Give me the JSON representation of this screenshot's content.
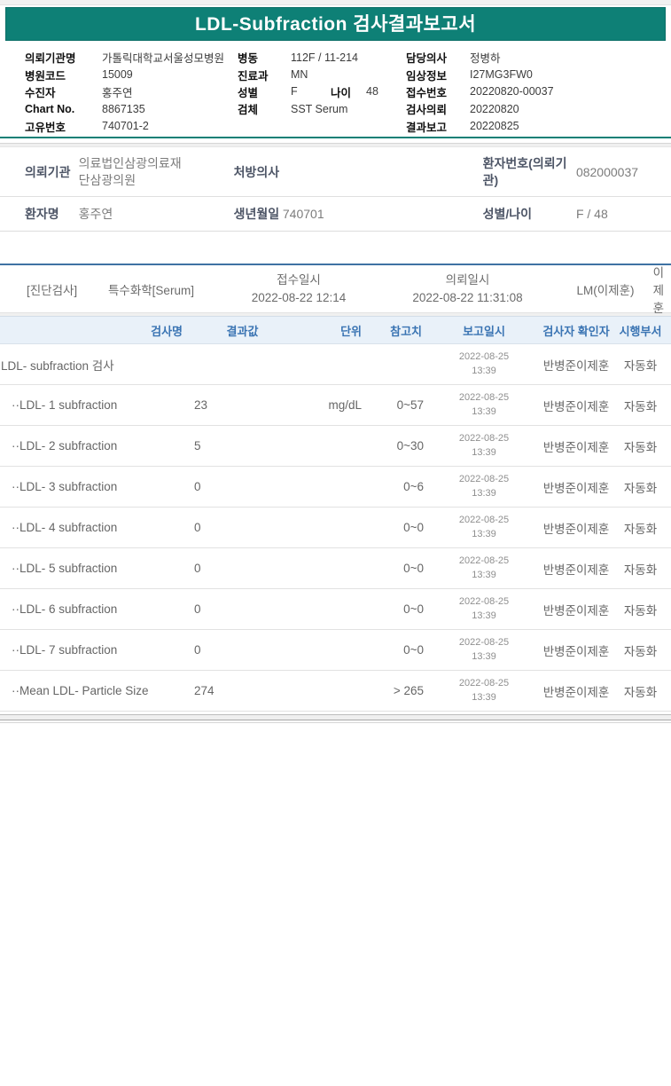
{
  "title": "LDL-Subfraction 검사결과보고서",
  "patient_info": {
    "col1": [
      {
        "label": "의뢰기관명",
        "value": "가톨릭대학교서울성모병원"
      },
      {
        "label": "병원코드",
        "value": "15009"
      },
      {
        "label": "수진자",
        "value": "홍주연"
      },
      {
        "label": "Chart No.",
        "value": "8867135"
      },
      {
        "label": "고유번호",
        "value": "740701-2"
      }
    ],
    "col2": [
      {
        "label": "병동",
        "value": "112F / 11-214"
      },
      {
        "label": "진료과",
        "value": "MN"
      },
      {
        "label": "성별",
        "value": "F",
        "label2": "나이",
        "value2": "48"
      },
      {
        "label": "검체",
        "value": "SST Serum"
      }
    ],
    "col3": [
      {
        "label": "담당의사",
        "value": "정병하"
      },
      {
        "label": "임상정보",
        "value": "I27MG3FW0"
      },
      {
        "label": "접수번호",
        "value": "20220820-00037"
      },
      {
        "label": "검사의뢰",
        "value": "20220820"
      },
      {
        "label": "결과보고",
        "value": "20220825"
      }
    ]
  },
  "referral": {
    "row1": {
      "org_label": "의뢰기관",
      "org_value": "의료법인삼광의료재단삼광의원",
      "doctor_label": "처방의사",
      "doctor_value": "",
      "patient_no_label": "환자번호(의뢰기관)",
      "patient_no_value": "082000037"
    },
    "row2": {
      "name_label": "환자명",
      "name_value": "홍주연",
      "birth_label": "생년월일",
      "birth_value": "740701",
      "sexage_label": "성별/나이",
      "sexage_value": "F / 48"
    }
  },
  "exam_section": {
    "category": "[진단검사]",
    "test_group": "특수화학[Serum]",
    "receipt_label": "접수일시",
    "receipt_value": "2022-08-22 12:14",
    "request_label": "의뢰일시",
    "request_value": "2022-08-22 11:31:08",
    "lab": "LM(이제훈)",
    "reporter": "이제훈"
  },
  "results_table": {
    "headers": {
      "name": "검사명",
      "result": "결과값",
      "unit": "단위",
      "reference": "참고치",
      "report": "보고일시",
      "examiner": "검사자 확인자",
      "department": "시행부서"
    },
    "rows": [
      {
        "name": "LDL- subfraction 검사",
        "result": "",
        "unit": "",
        "reference": "",
        "report_date": "2022-08-25",
        "report_time": "13:39",
        "examiner": "반병준이제훈",
        "department": "자동화"
      },
      {
        "name": "··LDL- 1 subfraction",
        "result": "23",
        "unit": "mg/dL",
        "reference": "0~57",
        "report_date": "2022-08-25",
        "report_time": "13:39",
        "examiner": "반병준이제훈",
        "department": "자동화"
      },
      {
        "name": "··LDL- 2 subfraction",
        "result": "5",
        "unit": "",
        "reference": "0~30",
        "report_date": "2022-08-25",
        "report_time": "13:39",
        "examiner": "반병준이제훈",
        "department": "자동화"
      },
      {
        "name": "··LDL- 3 subfraction",
        "result": "0",
        "unit": "",
        "reference": "0~6",
        "report_date": "2022-08-25",
        "report_time": "13:39",
        "examiner": "반병준이제훈",
        "department": "자동화"
      },
      {
        "name": "··LDL- 4 subfraction",
        "result": "0",
        "unit": "",
        "reference": "0~0",
        "report_date": "2022-08-25",
        "report_time": "13:39",
        "examiner": "반병준이제훈",
        "department": "자동화"
      },
      {
        "name": "··LDL- 5 subfraction",
        "result": "0",
        "unit": "",
        "reference": "0~0",
        "report_date": "2022-08-25",
        "report_time": "13:39",
        "examiner": "반병준이제훈",
        "department": "자동화"
      },
      {
        "name": "··LDL- 6 subfraction",
        "result": "0",
        "unit": "",
        "reference": "0~0",
        "report_date": "2022-08-25",
        "report_time": "13:39",
        "examiner": "반병준이제훈",
        "department": "자동화"
      },
      {
        "name": "··LDL- 7 subfraction",
        "result": "0",
        "unit": "",
        "reference": "0~0",
        "report_date": "2022-08-25",
        "report_time": "13:39",
        "examiner": "반병준이제훈",
        "department": "자동화"
      },
      {
        "name": "··Mean LDL- Particle Size",
        "result": "274",
        "unit": "",
        "reference": "> 265",
        "report_date": "2022-08-25",
        "report_time": "13:39",
        "examiner": "반병준이제훈",
        "department": "자동화"
      }
    ]
  },
  "colors": {
    "accent_teal": "#0e8076",
    "header_blue_bg": "#e9f1f9",
    "header_blue_text": "#3a74b3",
    "rule_blue": "#3f72a3"
  }
}
